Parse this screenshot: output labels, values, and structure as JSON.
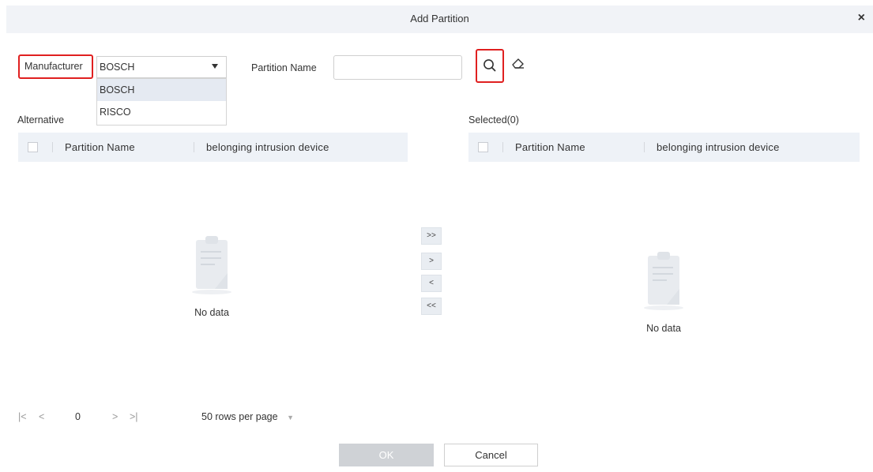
{
  "dialog": {
    "title": "Add Partition",
    "close_icon": "close-icon"
  },
  "filters": {
    "manufacturer_label": "Manufacturer",
    "manufacturer_value": "BOSCH",
    "manufacturer_options": [
      "BOSCH",
      "RISCO"
    ],
    "partition_name_label": "Partition Name",
    "partition_name_value": "",
    "search_icon": "search-icon",
    "clear_icon": "eraser-icon"
  },
  "alternative": {
    "label": "Alternative",
    "columns": [
      "Partition Name",
      "belonging intrusion device"
    ],
    "empty_text": "No data"
  },
  "selected": {
    "label": "Selected(0)",
    "columns": [
      "Partition Name",
      "belonging intrusion device"
    ],
    "empty_text": "No data"
  },
  "transfer": {
    "all_right": ">>",
    "right": ">",
    "left": "<",
    "all_left": "<<"
  },
  "pager": {
    "first": "|<",
    "prev": "<",
    "page": "0",
    "next": ">",
    "last": ">|",
    "rows_per_page": "50 rows per page"
  },
  "footer": {
    "ok_label": "OK",
    "cancel_label": "Cancel"
  }
}
